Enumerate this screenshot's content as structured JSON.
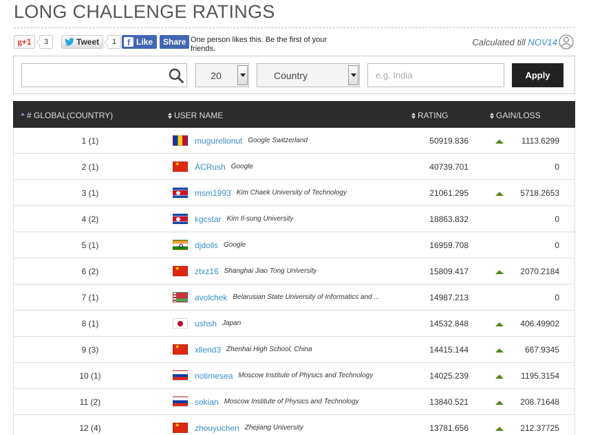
{
  "page": {
    "title": "LONG CHALLENGE RATINGS"
  },
  "social": {
    "gplus_label": "+1",
    "gplus_count": "3",
    "tweet_label": "Tweet",
    "tweet_count": "1",
    "like_label": "Like",
    "share_label": "Share",
    "fb_text": "One person likes this. Be the first of your friends."
  },
  "calc": {
    "prefix": "Calculated till",
    "contest": "NOV14"
  },
  "filters": {
    "search_value": "",
    "page_size": "20",
    "country_select": "Country",
    "country_placeholder": "e.g. India",
    "apply_label": "Apply"
  },
  "table": {
    "headers": {
      "global": "# GLOBAL(COUNTRY)",
      "user": "USER NAME",
      "rating": "RATING",
      "gain": "GAIN/LOSS"
    },
    "rows": [
      {
        "rank": "1 (1)",
        "flag": "ro",
        "user": "mugurelionut",
        "inst": "Google Switzerland",
        "rating": "50919.836",
        "up": true,
        "gain": "1113.6299"
      },
      {
        "rank": "2 (1)",
        "flag": "cn",
        "user": "ACRush",
        "inst": "Google",
        "rating": "40739.701",
        "up": false,
        "gain": "0"
      },
      {
        "rank": "3 (1)",
        "flag": "kp",
        "user": "msm1993",
        "inst": "Kim Chaek University of Technology",
        "rating": "21061.295",
        "up": true,
        "gain": "5718.2653"
      },
      {
        "rank": "4 (2)",
        "flag": "kp",
        "user": "kgcstar",
        "inst": "Kim Il-sung University",
        "rating": "18863.832",
        "up": false,
        "gain": "0"
      },
      {
        "rank": "5 (1)",
        "flag": "in",
        "user": "djdolls",
        "inst": "Google",
        "rating": "16959.708",
        "up": false,
        "gain": "0"
      },
      {
        "rank": "6 (2)",
        "flag": "cn",
        "user": "ztxz16",
        "inst": "Shanghai Jiao Tong University",
        "rating": "15809.417",
        "up": true,
        "gain": "2070.2184"
      },
      {
        "rank": "7 (1)",
        "flag": "by",
        "user": "avolchek",
        "inst": "Belarusian State University of Informatics and ...",
        "rating": "14987.213",
        "up": false,
        "gain": "0"
      },
      {
        "rank": "8 (1)",
        "flag": "jp",
        "user": "ushsh",
        "inst": "Japan",
        "rating": "14532.848",
        "up": true,
        "gain": "406.49902"
      },
      {
        "rank": "9 (3)",
        "flag": "cn",
        "user": "xllend3",
        "inst": "Zhenhai High School, China",
        "rating": "14415.144",
        "up": true,
        "gain": "667.9345"
      },
      {
        "rank": "10 (1)",
        "flag": "ru",
        "user": "notimesea",
        "inst": "Moscow Institute of Physics and Technology",
        "rating": "14025.239",
        "up": true,
        "gain": "1195.3154"
      },
      {
        "rank": "11 (2)",
        "flag": "ru",
        "user": "sokian",
        "inst": "Moscow Institute of Physics and Technology",
        "rating": "13840.521",
        "up": true,
        "gain": "208.71648"
      },
      {
        "rank": "12 (4)",
        "flag": "cn",
        "user": "zhouyuchen",
        "inst": "Zhejiang University",
        "rating": "13781.656",
        "up": true,
        "gain": "212.37725"
      }
    ]
  }
}
